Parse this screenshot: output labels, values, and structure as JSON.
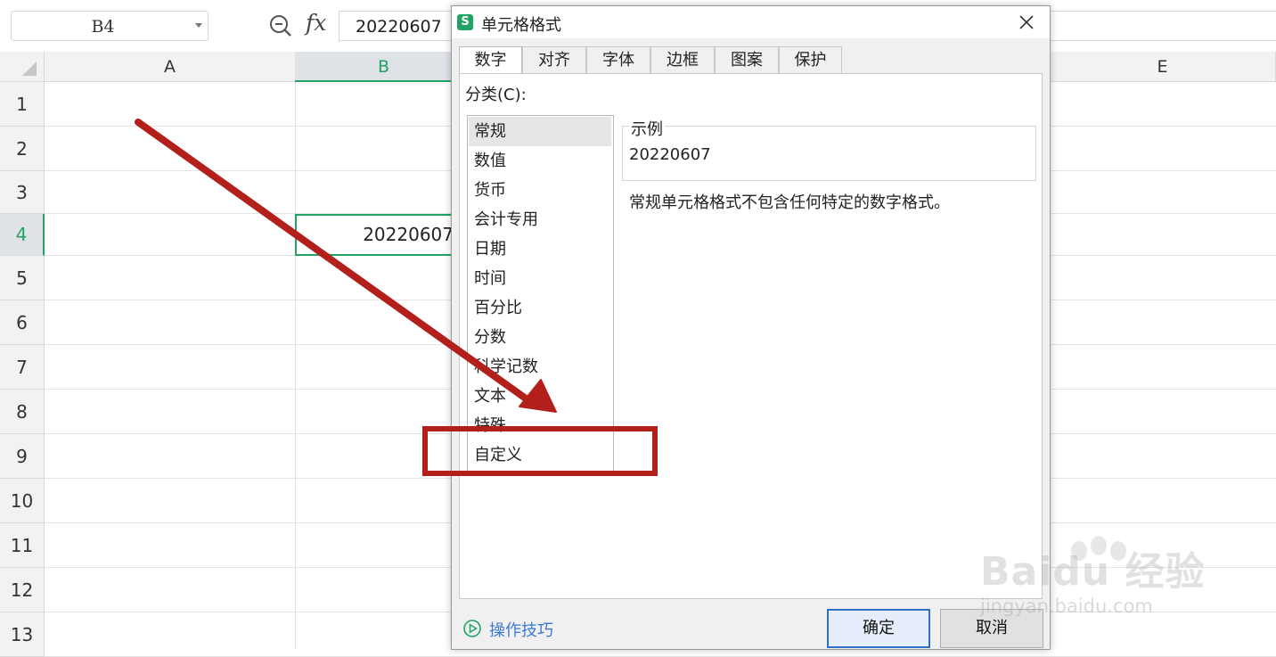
{
  "formula_bar": {
    "cell_ref": "B4",
    "fx_label": "fx",
    "value": "20220607"
  },
  "grid": {
    "columns": [
      "A",
      "B",
      "E"
    ],
    "rows": [
      "1",
      "2",
      "3",
      "4",
      "5",
      "6",
      "7",
      "8",
      "9",
      "10",
      "11",
      "12",
      "13"
    ],
    "selected_column": "B",
    "selected_row": "4",
    "cell_b4": "20220607"
  },
  "dialog": {
    "title": "单元格格式",
    "tabs": [
      {
        "label": "数字"
      },
      {
        "label": "对齐"
      },
      {
        "label": "字体"
      },
      {
        "label": "边框"
      },
      {
        "label": "图案"
      },
      {
        "label": "保护"
      }
    ],
    "active_tab": "数字",
    "category_label": "分类(C):",
    "categories": [
      {
        "label": "常规"
      },
      {
        "label": "数值"
      },
      {
        "label": "货币"
      },
      {
        "label": "会计专用"
      },
      {
        "label": "日期"
      },
      {
        "label": "时间"
      },
      {
        "label": "百分比"
      },
      {
        "label": "分数"
      },
      {
        "label": "科学记数"
      },
      {
        "label": "文本"
      },
      {
        "label": "特殊"
      },
      {
        "label": "自定义"
      }
    ],
    "selected_category": "常规",
    "sample_legend": "示例",
    "sample_value": "20220607",
    "description": "常规单元格格式不包含任何特定的数字格式。",
    "tips_link": "操作技巧",
    "ok_label": "确定",
    "cancel_label": "取消"
  },
  "annotation": {
    "arrow_color": "#b3201c",
    "highlight_target": "自定义"
  },
  "watermark": {
    "logo_text": "Baidu 经验",
    "url": "jingyan.baidu.com"
  },
  "colors": {
    "accent_green": "#21a366",
    "link_blue": "#3b7bd4",
    "primary_button_border": "#2f6fc6"
  }
}
